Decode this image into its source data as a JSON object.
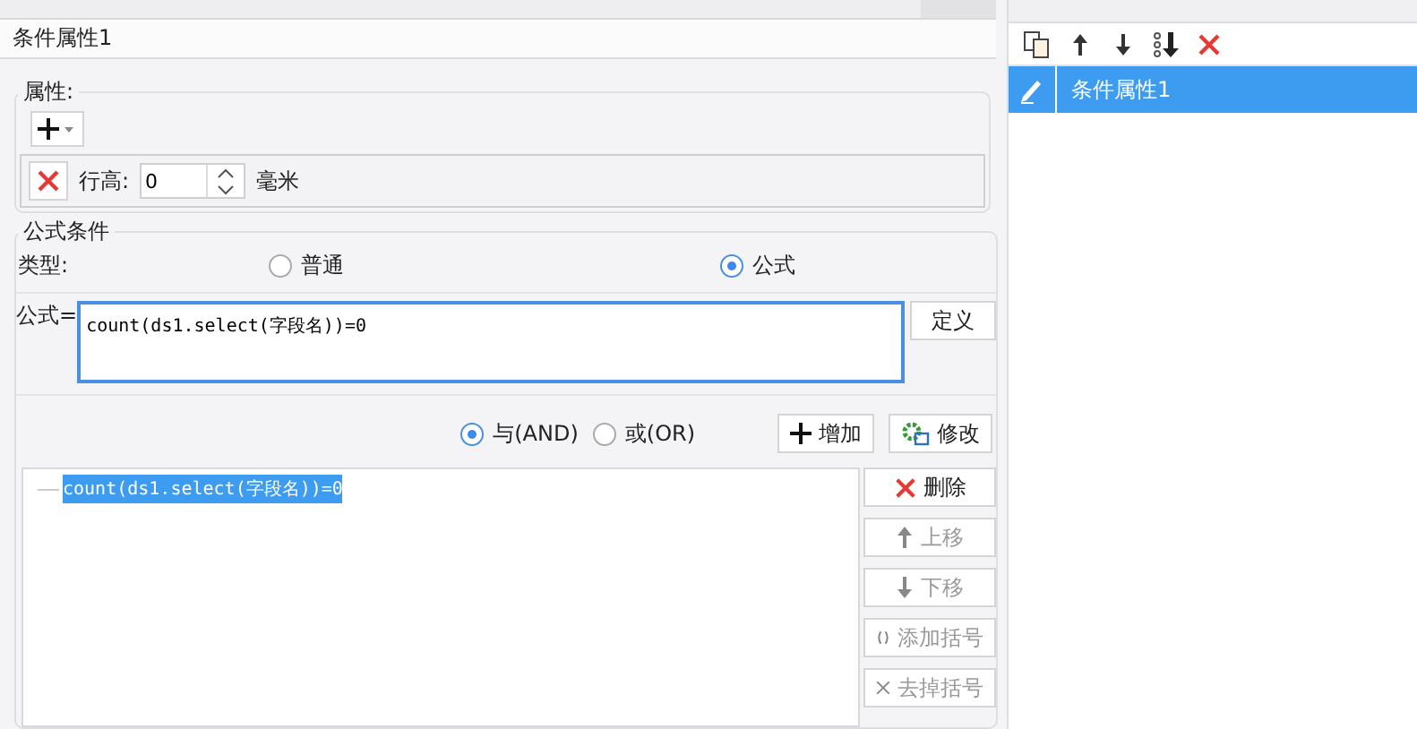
{
  "header": {
    "title": "条件属性1"
  },
  "attributes": {
    "legend": "属性:",
    "rows": [
      {
        "label": "行高:",
        "value": "0",
        "unit": "毫米"
      }
    ]
  },
  "formula_condition": {
    "legend": "公式条件",
    "type_label": "类型:",
    "types": [
      {
        "label": "普通",
        "selected": false
      },
      {
        "label": "公式",
        "selected": true
      }
    ],
    "formula_label": "公式=",
    "formula": "count(ds1.select(字段名))=0",
    "define_button": "定义",
    "logic": [
      {
        "label": "与(AND)",
        "selected": true
      },
      {
        "label": "或(OR)",
        "selected": false
      }
    ],
    "add_button": "增加",
    "modify_button": "修改",
    "conditions": [
      {
        "text": "count(ds1.select(字段名))=0",
        "selected": true
      }
    ],
    "actions": [
      {
        "kind": "delete",
        "label": "删除",
        "disabled": false
      },
      {
        "kind": "up",
        "label": "上移",
        "disabled": true
      },
      {
        "kind": "down",
        "label": "下移",
        "disabled": true
      },
      {
        "kind": "add_bracket",
        "label": "添加括号",
        "disabled": true
      },
      {
        "kind": "remove_bracket",
        "label": "去掉括号",
        "disabled": true
      }
    ]
  },
  "condition_list": {
    "items": [
      {
        "label": "条件属性1",
        "selected": true
      }
    ]
  }
}
